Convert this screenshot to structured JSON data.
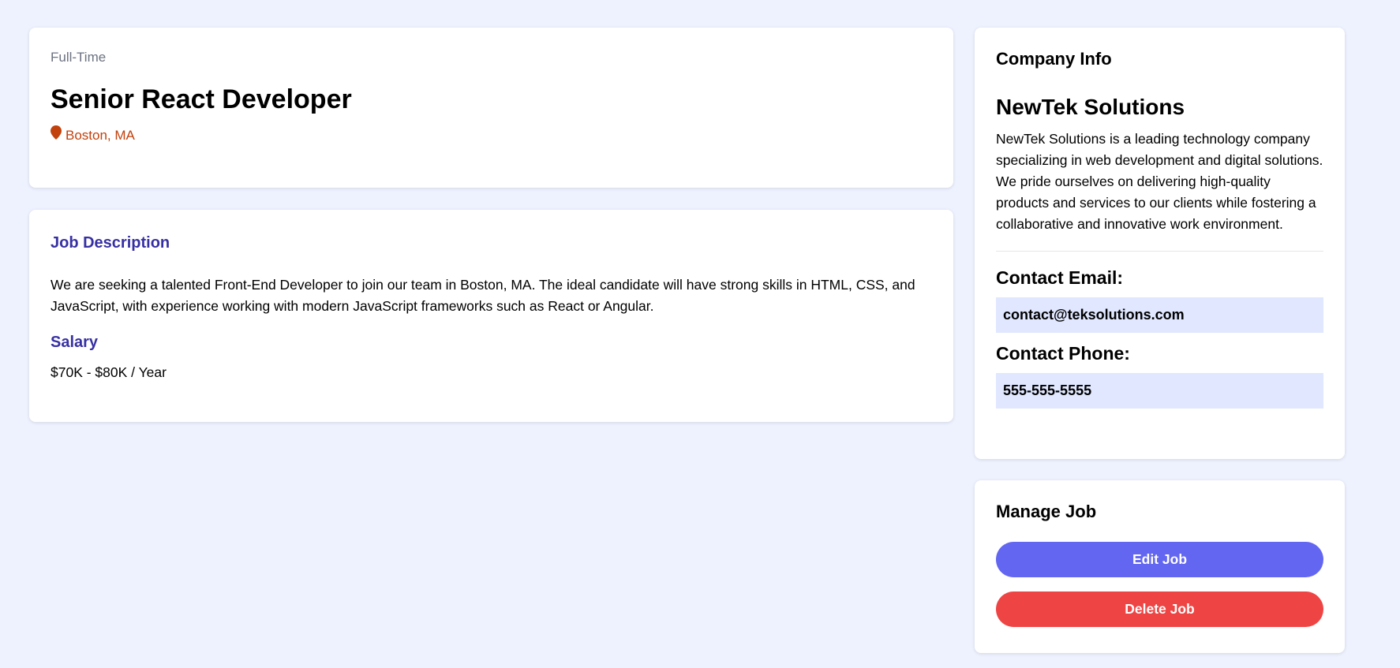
{
  "job": {
    "type": "Full-Time",
    "title": "Senior React Developer",
    "location": "Boston, MA",
    "description_heading": "Job Description",
    "description": "We are seeking a talented Front-End Developer to join our team in Boston, MA. The ideal candidate will have strong skills in HTML, CSS, and JavaScript, with experience working with modern JavaScript frameworks such as React or Angular.",
    "salary_heading": "Salary",
    "salary": "$70K - $80K / Year"
  },
  "company": {
    "heading": "Company Info",
    "name": "NewTek Solutions",
    "description": "NewTek Solutions is a leading technology company specializing in web development and digital solutions. We pride ourselves on delivering high-quality products and services to our clients while fostering a collaborative and innovative work environment.",
    "email_label": "Contact Email:",
    "email": "contact@teksolutions.com",
    "phone_label": "Contact Phone:",
    "phone": "555-555-5555"
  },
  "manage": {
    "heading": "Manage Job",
    "edit_label": "Edit Job",
    "delete_label": "Delete Job"
  },
  "colors": {
    "background": "#eef2ff",
    "accent_heading": "#3730a3",
    "location": "#c2410c",
    "edit_button": "#6366f1",
    "delete_button": "#ef4444",
    "contact_box": "#e0e7ff"
  },
  "icons": {
    "location": "map-marker-icon"
  }
}
